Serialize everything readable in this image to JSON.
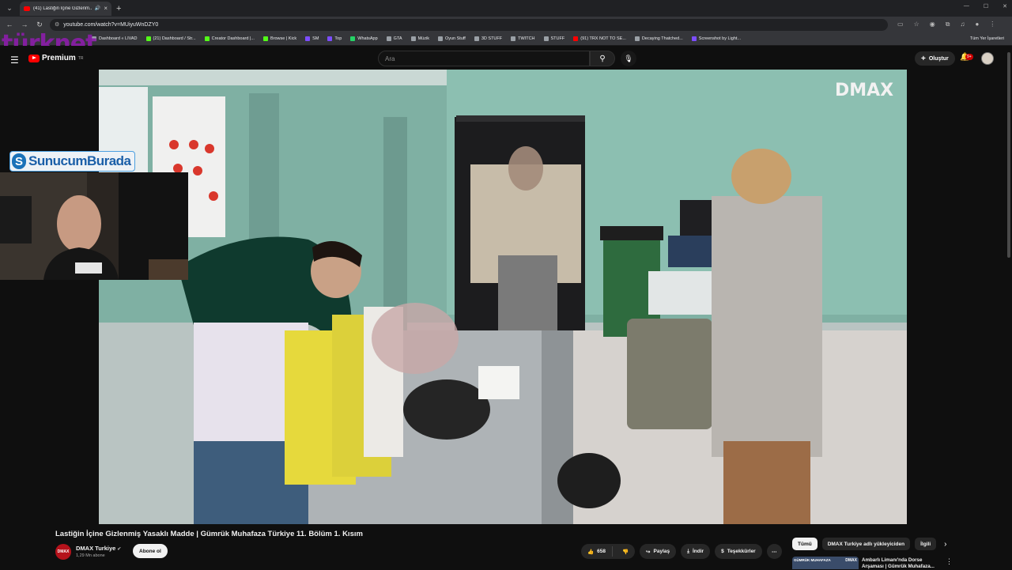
{
  "browser": {
    "tab_title": "(41) Lastiğin İçine Gizlenm...",
    "url": "youtube.com/watch?v=MUiyuWnDZY0",
    "bookmarks": [
      {
        "label": "Dashboard « LIVAD",
        "color": "#9aa0a6"
      },
      {
        "label": "(21) Dashboard / Str...",
        "color": "#53fc18"
      },
      {
        "label": "Creator Dashboard |...",
        "color": "#53fc18"
      },
      {
        "label": "Browse | Kick",
        "color": "#53fc18"
      },
      {
        "label": "SM",
        "color": "#7c4dff"
      },
      {
        "label": "Top",
        "color": "#7c4dff"
      },
      {
        "label": "WhatsApp",
        "color": "#25d366"
      },
      {
        "label": "GTA",
        "color": "#9aa0a6"
      },
      {
        "label": "Müzik",
        "color": "#9aa0a6"
      },
      {
        "label": "Oyun Stuff",
        "color": "#9aa0a6"
      },
      {
        "label": "3D STUFF",
        "color": "#9aa0a6"
      },
      {
        "label": "TWITCH",
        "color": "#9aa0a6"
      },
      {
        "label": "STUFF",
        "color": "#9aa0a6"
      },
      {
        "label": "(91) TRX NOT TO SE...",
        "color": "#ff0000"
      },
      {
        "label": "Decaying Thatched...",
        "color": "#9aa0a6"
      },
      {
        "label": "Screenshot by Light...",
        "color": "#7c4dff"
      }
    ],
    "bookmarks_right": "Tüm Yer İşaretleri"
  },
  "overlay": {
    "turknet": "türknet",
    "sunucum": "SunucumBurada",
    "sunucum_mark": "S"
  },
  "youtube": {
    "brand": "Premium",
    "brand_sup": "TR",
    "search_placeholder": "Ara",
    "create_label": "Oluştur",
    "notif_count": "9+"
  },
  "player": {
    "watermark": "DMAX"
  },
  "video": {
    "title": "Lastiğin İçine Gizlenmiş Yasaklı Madde | Gümrük Muhafaza Türkiye 11. Bölüm 1. Kısım",
    "channel_name": "DMAX Turkiye",
    "channel_avatar_text": "DMAX",
    "subscribers": "1,29 Mn abone",
    "subscribe_label": "Abone ol",
    "likes": "658",
    "share_label": "Paylaş",
    "download_label": "İndir",
    "thanks_label": "Teşekkürler"
  },
  "chips": [
    "Tümü",
    "DMAX Turkiye adlı yükleyiciden",
    "İlgili"
  ],
  "recommendation": {
    "thumb_label": "GÜMRÜK MUHAFAZA",
    "thumb_brand": "DMAX",
    "title_line1": "Ambarlı Limanı'nda Dorse",
    "title_line2": "Arşaması | Gümrük Muhafaza..."
  }
}
